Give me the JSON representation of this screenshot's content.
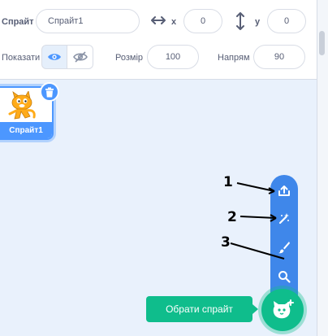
{
  "info_panel": {
    "sprite_label": "Спрайт",
    "sprite_name": "Спрайт1",
    "x_label": "x",
    "x_value": "0",
    "y_label": "y",
    "y_value": "0",
    "show_label": "Показати",
    "size_label": "Розмір",
    "size_value": "100",
    "direction_label": "Напрям",
    "direction_value": "90"
  },
  "sprite_list": {
    "items": [
      {
        "label": "Спрайт1",
        "selected": true
      }
    ]
  },
  "sprite_menu": {
    "items": [
      {
        "icon": "upload-icon"
      },
      {
        "icon": "surprise-icon"
      },
      {
        "icon": "paint-icon"
      },
      {
        "icon": "search-icon"
      }
    ],
    "main_button_icon": "cat-plus-icon",
    "tooltip": "Обрати спрайт"
  },
  "callouts": [
    "1",
    "2",
    "3"
  ],
  "colors": {
    "accent_blue": "#4c97ff",
    "menu_blue": "#3f87ea",
    "green": "#0fbd8c",
    "background": "#e9f1fc"
  }
}
